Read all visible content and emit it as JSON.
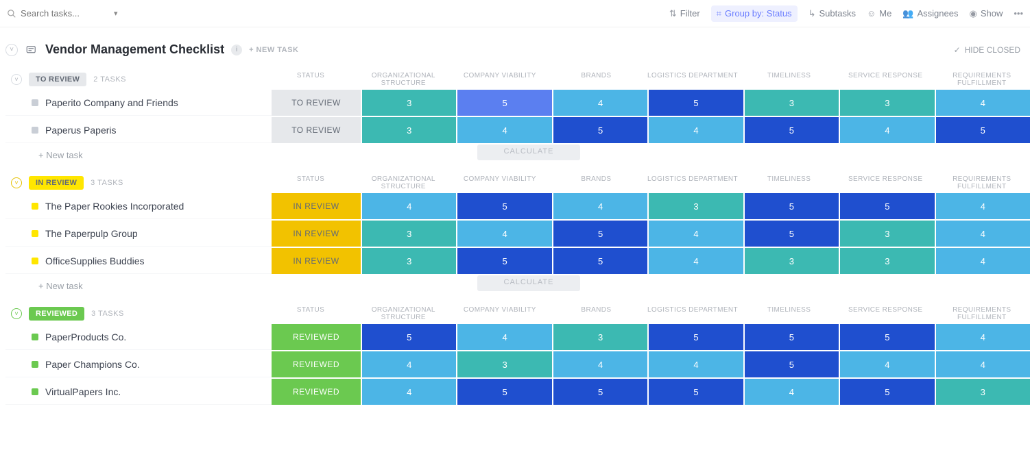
{
  "search": {
    "placeholder": "Search tasks..."
  },
  "toolbar": {
    "filter": "Filter",
    "group_by": "Group by: Status",
    "subtasks": "Subtasks",
    "me": "Me",
    "assignees": "Assignees",
    "show": "Show"
  },
  "list": {
    "title": "Vendor Management Checklist",
    "new_task_header": "+ NEW TASK",
    "hide_closed": "HIDE CLOSED"
  },
  "columns": {
    "status": "STATUS",
    "org": "ORGANIZATIONAL STRUCTURE",
    "viability": "COMPANY VIABILITY",
    "brands": "BRANDS",
    "logistics": "LOGISTICS DEPARTMENT",
    "timeliness": "TIMELINESS",
    "service": "SERVICE RESPONSE",
    "requirements": "REQUIREMENTS FULFILLMENT"
  },
  "common": {
    "new_task": "+ New task",
    "calculate": "CALCULATE"
  },
  "groups": [
    {
      "id": "toreview",
      "label": "TO REVIEW",
      "count": "2 TASKS",
      "tasks": [
        {
          "name": "Paperito Company and Friends",
          "status": "TO REVIEW",
          "values": {
            "org": 3,
            "viability": 5,
            "brands": 4,
            "logistics": 5,
            "timeliness": 3,
            "service": 3,
            "requirements": 4
          }
        },
        {
          "name": "Paperus Paperis",
          "status": "TO REVIEW",
          "values": {
            "org": 3,
            "viability": 4,
            "brands": 5,
            "logistics": 4,
            "timeliness": 5,
            "service": 4,
            "requirements": 5
          }
        }
      ]
    },
    {
      "id": "inreview",
      "label": "IN REVIEW",
      "count": "3 TASKS",
      "tasks": [
        {
          "name": "The Paper Rookies Incorporated",
          "status": "IN REVIEW",
          "values": {
            "org": 4,
            "viability": 5,
            "brands": 4,
            "logistics": 3,
            "timeliness": 5,
            "service": 5,
            "requirements": 4
          }
        },
        {
          "name": "The Paperpulp Group",
          "status": "IN REVIEW",
          "values": {
            "org": 3,
            "viability": 4,
            "brands": 5,
            "logistics": 4,
            "timeliness": 5,
            "service": 3,
            "requirements": 4
          }
        },
        {
          "name": "OfficeSupplies Buddies",
          "status": "IN REVIEW",
          "values": {
            "org": 3,
            "viability": 5,
            "brands": 5,
            "logistics": 4,
            "timeliness": 3,
            "service": 3,
            "requirements": 4
          }
        }
      ]
    },
    {
      "id": "reviewed",
      "label": "REVIEWED",
      "count": "3 TASKS",
      "tasks": [
        {
          "name": "PaperProducts Co.",
          "status": "REVIEWED",
          "values": {
            "org": 5,
            "viability": 4,
            "brands": 3,
            "logistics": 5,
            "timeliness": 5,
            "service": 5,
            "requirements": 4
          }
        },
        {
          "name": "Paper Champions Co.",
          "status": "REVIEWED",
          "values": {
            "org": 4,
            "viability": 3,
            "brands": 4,
            "logistics": 4,
            "timeliness": 5,
            "service": 4,
            "requirements": 4
          }
        },
        {
          "name": "VirtualPapers Inc.",
          "status": "REVIEWED",
          "values": {
            "org": 4,
            "viability": 5,
            "brands": 5,
            "logistics": 5,
            "timeliness": 4,
            "service": 5,
            "requirements": 3
          }
        }
      ]
    }
  ],
  "value_colors": {
    "3": "teal",
    "4": "sky",
    "5": "royal"
  },
  "cell_overrides": {
    "toreview-0-viability": "blue"
  }
}
